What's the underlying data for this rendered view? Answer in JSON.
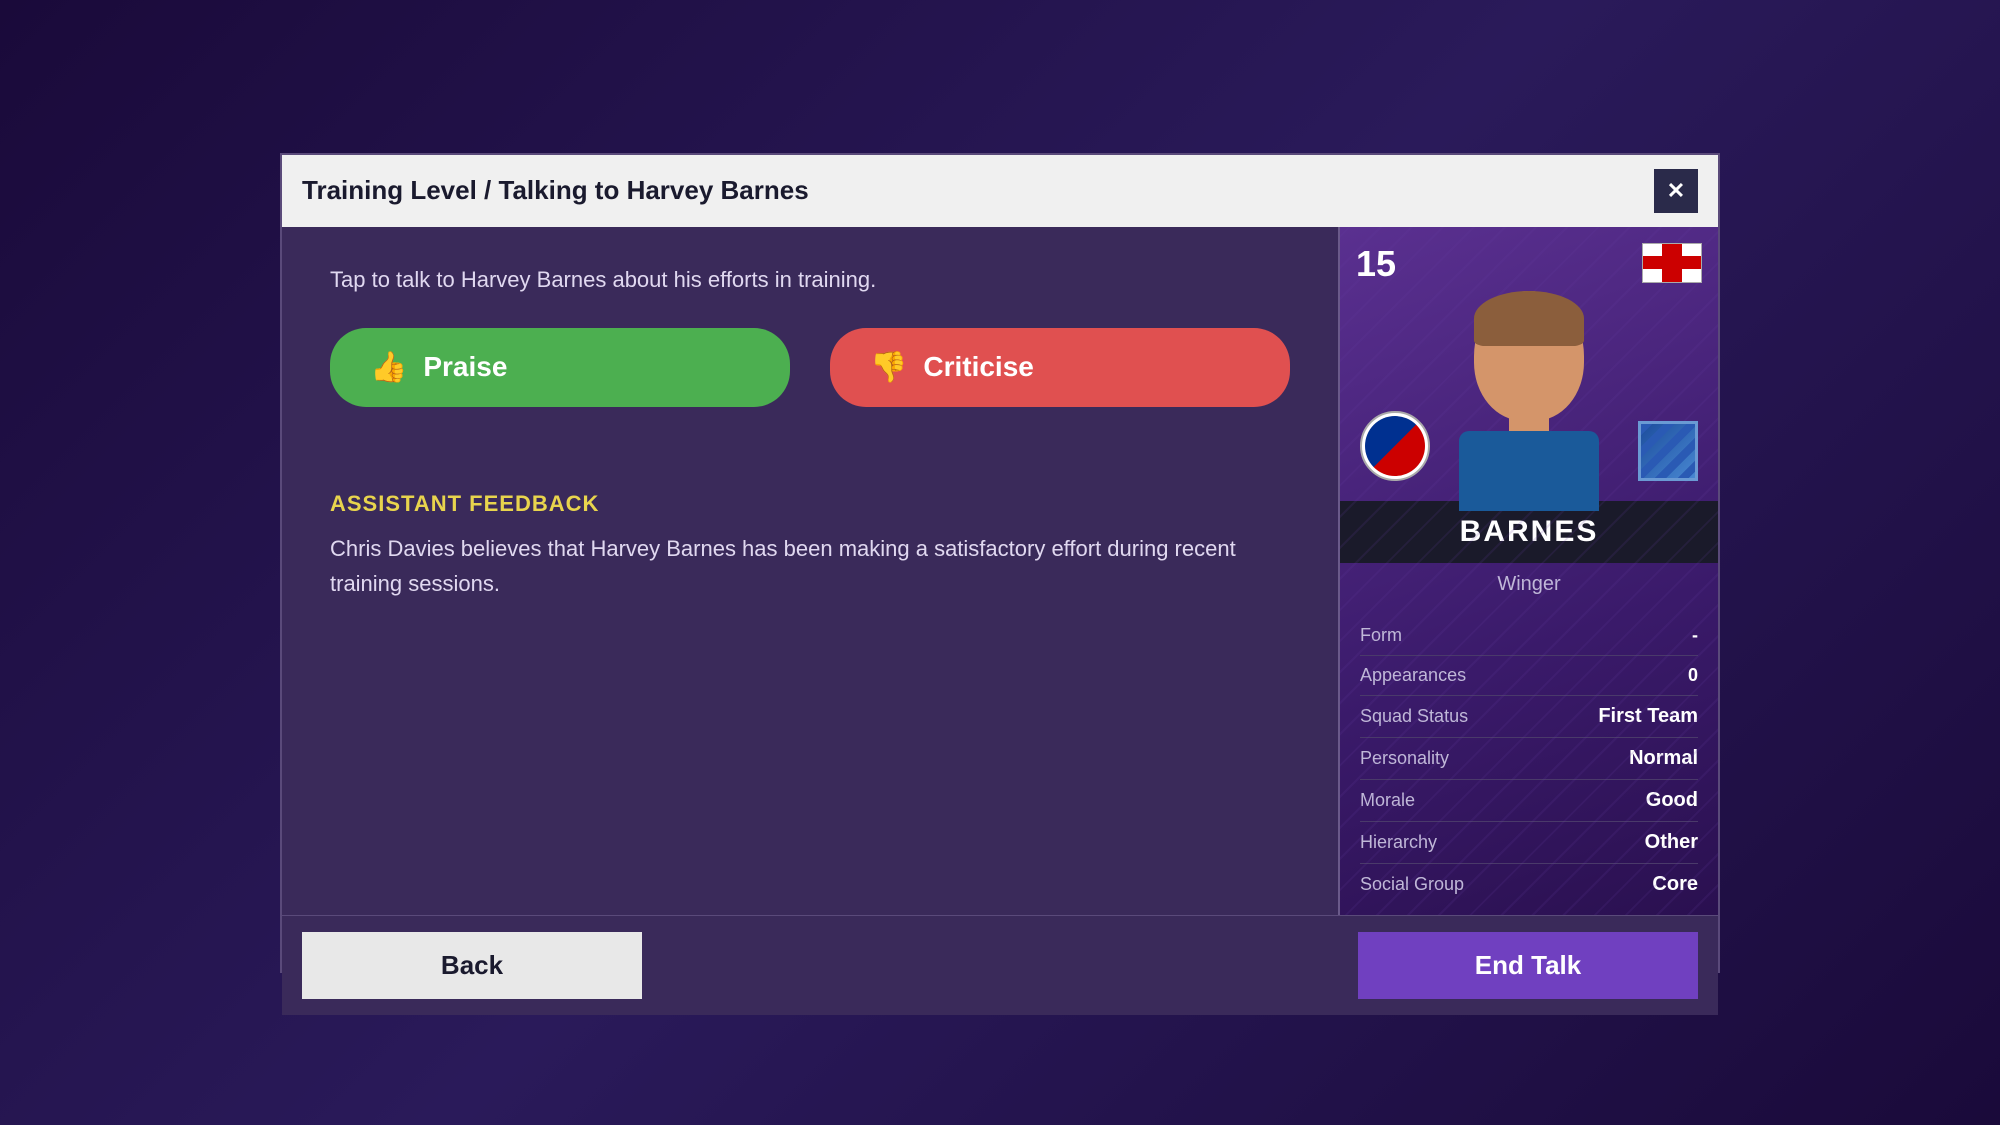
{
  "modal": {
    "title": "Training Level / Talking to Harvey Barnes",
    "close_label": "✕",
    "intro_text": "Tap to talk to Harvey Barnes about his efforts in training."
  },
  "buttons": {
    "praise_label": "Praise",
    "praise_icon": "👍",
    "criticise_label": "Criticise",
    "criticise_icon": "👎",
    "back_label": "Back",
    "end_talk_label": "End Talk"
  },
  "assistant": {
    "section_title": "ASSISTANT FEEDBACK",
    "feedback_text": "Chris Davies believes that Harvey Barnes has been making a satisfactory effort during recent training sessions."
  },
  "player": {
    "number": "15",
    "name": "BARNES",
    "position": "Winger",
    "stats": {
      "form_label": "Form",
      "form_value": "-",
      "appearances_label": "Appearances",
      "appearances_value": "0",
      "squad_status_label": "Squad Status",
      "squad_status_value": "First Team",
      "personality_label": "Personality",
      "personality_value": "Normal",
      "morale_label": "Morale",
      "morale_value": "Good",
      "hierarchy_label": "Hierarchy",
      "hierarchy_value": "Other",
      "social_group_label": "Social Group",
      "social_group_value": "Core"
    }
  }
}
